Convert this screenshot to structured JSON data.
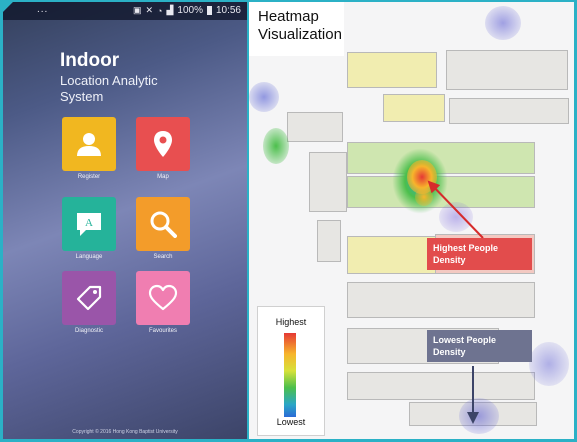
{
  "status_bar": {
    "dots": "...",
    "battery": "100%",
    "time": "10:56"
  },
  "app": {
    "title": "Indoor",
    "subtitle": "Location Analytic System",
    "tiles": [
      {
        "label": "Register",
        "icon": "user-icon",
        "color": "#f1b720"
      },
      {
        "label": "Map",
        "icon": "map-pin-icon",
        "color": "#e84f50"
      },
      {
        "label": "Language",
        "icon": "language-icon",
        "color": "#25b39a"
      },
      {
        "label": "Search",
        "icon": "search-icon",
        "color": "#f39c2a"
      },
      {
        "label": "Diagnostic",
        "icon": "tag-icon",
        "color": "#9a55a9"
      },
      {
        "label": "Favourites",
        "icon": "heart-icon",
        "color": "#f07eb1"
      }
    ],
    "copyright": "Copyright © 2016 Hong Kong Baptist University"
  },
  "heatmap": {
    "title": "Heatmap Visualization",
    "highest_callout": "Highest People Density",
    "lowest_callout": "Lowest People Density",
    "legend": {
      "high": "Highest",
      "low": "Lowest"
    },
    "colors": {
      "high": "#e53935",
      "low": "#2b6bd6",
      "frame": "#2bb1c6"
    }
  }
}
